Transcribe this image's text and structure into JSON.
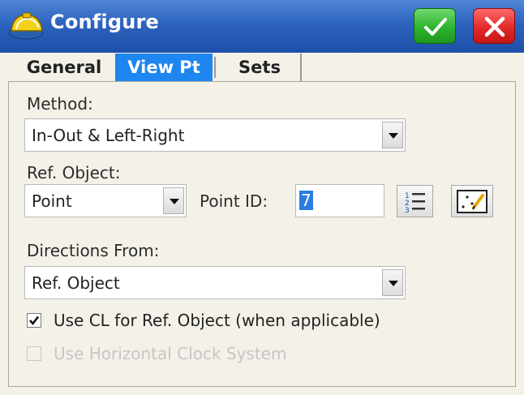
{
  "window": {
    "title": "Configure"
  },
  "tabs": [
    {
      "label": "General",
      "selected": false
    },
    {
      "label": "View Pt",
      "selected": true
    },
    {
      "label": "Sets",
      "selected": false
    }
  ],
  "method": {
    "label": "Method:",
    "value": "In-Out & Left-Right"
  },
  "ref_object": {
    "label": "Ref. Object:",
    "value": "Point"
  },
  "point_id": {
    "label": "Point ID:",
    "value": "7"
  },
  "directions_from": {
    "label": "Directions From:",
    "value": "Ref. Object"
  },
  "options": [
    {
      "label": "Use CL for Ref. Object (when applicable)",
      "checked": true,
      "enabled": true
    },
    {
      "label": "Use Horizontal Clock System",
      "checked": false,
      "enabled": false
    }
  ],
  "icons": {
    "ok": "checkmark-icon",
    "close": "close-icon",
    "list": "list-icon",
    "map": "map-select-icon",
    "app": "hard-hat-icon"
  },
  "colors": {
    "titlebar": "#2c63be",
    "active_tab": "#1d86f1",
    "ok": "#2fb32f",
    "close": "#e22a2a",
    "selection": "#2a7de0"
  }
}
